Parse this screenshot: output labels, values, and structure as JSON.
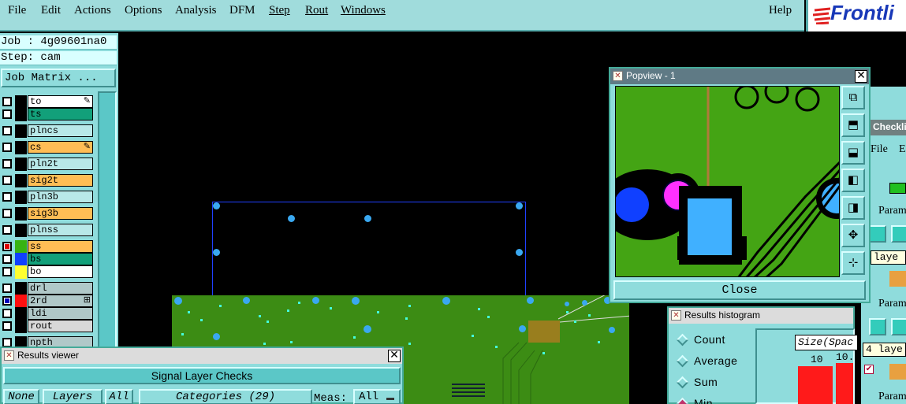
{
  "menu": {
    "items": [
      "File",
      "Edit",
      "Actions",
      "Options",
      "Analysis",
      "DFM",
      "Step",
      "Rout",
      "Windows"
    ],
    "help": "Help"
  },
  "logo": {
    "text": "Frontli"
  },
  "job": {
    "job_line": "Job : 4g09601na0",
    "step_line": "Step: cam",
    "matrix_button": "Job Matrix ..."
  },
  "layers": [
    {
      "name": "to",
      "color": "#ffffff",
      "swatch": "#000000",
      "mark": "✎",
      "chk": ""
    },
    {
      "name": "ts",
      "color": "#12a07a",
      "swatch": "#000000",
      "mark": "",
      "chk": ""
    },
    {
      "name": "plncs",
      "color": "#b8e8e8",
      "swatch": "#000000",
      "mark": "",
      "chk": ""
    },
    {
      "name": "cs",
      "color": "#ffbd55",
      "swatch": "#000000",
      "mark": "✎",
      "chk": ""
    },
    {
      "name": "pln2t",
      "color": "#b8e8e8",
      "swatch": "#000000",
      "mark": "",
      "chk": ""
    },
    {
      "name": "sig2t",
      "color": "#ffbd55",
      "swatch": "#000000",
      "mark": "",
      "chk": ""
    },
    {
      "name": "pln3b",
      "color": "#b8e8e8",
      "swatch": "#000000",
      "mark": "",
      "chk": ""
    },
    {
      "name": "sig3b",
      "color": "#ffbd55",
      "swatch": "#000000",
      "mark": "",
      "chk": ""
    },
    {
      "name": "plnss",
      "color": "#b8e8e8",
      "swatch": "#000000",
      "mark": "",
      "chk": ""
    },
    {
      "name": "ss",
      "color": "#ffbd55",
      "swatch": "#37b312",
      "mark": "",
      "chk": "filled"
    },
    {
      "name": "bs",
      "color": "#12a07a",
      "swatch": "#1040ff",
      "mark": "",
      "chk": ""
    },
    {
      "name": "bo",
      "color": "#ffffff",
      "swatch": "#ffff30",
      "mark": "",
      "chk": ""
    },
    {
      "name": "drl",
      "color": "#b0c8c8",
      "swatch": "#000000",
      "mark": "",
      "chk": ""
    },
    {
      "name": "2rd",
      "color": "#b0c8c8",
      "swatch": "#ff1010",
      "mark": "⊞",
      "chk": "filled2"
    },
    {
      "name": "ldi",
      "color": "#b0c8c8",
      "swatch": "#000000",
      "mark": "",
      "chk": ""
    },
    {
      "name": "rout",
      "color": "#d8d8d8",
      "swatch": "#000000",
      "mark": "",
      "chk": ""
    },
    {
      "name": "npth",
      "color": "#b0c8c8",
      "swatch": "#000000",
      "mark": "",
      "chk": ""
    }
  ],
  "popview": {
    "title": "Popview - 1",
    "close": "Close",
    "tools": [
      "zoom-fit-icon",
      "pan-up-icon",
      "pan-down-icon",
      "pan-left-icon",
      "pan-right-icon",
      "zoom-in-icon",
      "zoom-out-icon"
    ]
  },
  "histogram": {
    "title": "Results histogram",
    "options": [
      {
        "label": "Count",
        "selected": false
      },
      {
        "label": "Average",
        "selected": false
      },
      {
        "label": "Sum",
        "selected": false
      },
      {
        "label": "Min",
        "selected": true
      }
    ],
    "size_label": "Size(Spac",
    "bar_labels": [
      "10",
      "10."
    ],
    "bar_color": "#ff1a1a"
  },
  "checklist": {
    "title": "Checkli",
    "menu_file": "File",
    "menu_e": "E",
    "param1": "Param",
    "layer1": "laye",
    "param2": "Param",
    "layer2": "4 laye",
    "param3": "Param"
  },
  "results_viewer": {
    "title": "Results viewer",
    "header": "Signal Layer Checks",
    "none": "None",
    "layers": "Layers",
    "all": "All",
    "categories": "Categories (29)",
    "meas_label": "Meas:",
    "meas_value": "All"
  }
}
